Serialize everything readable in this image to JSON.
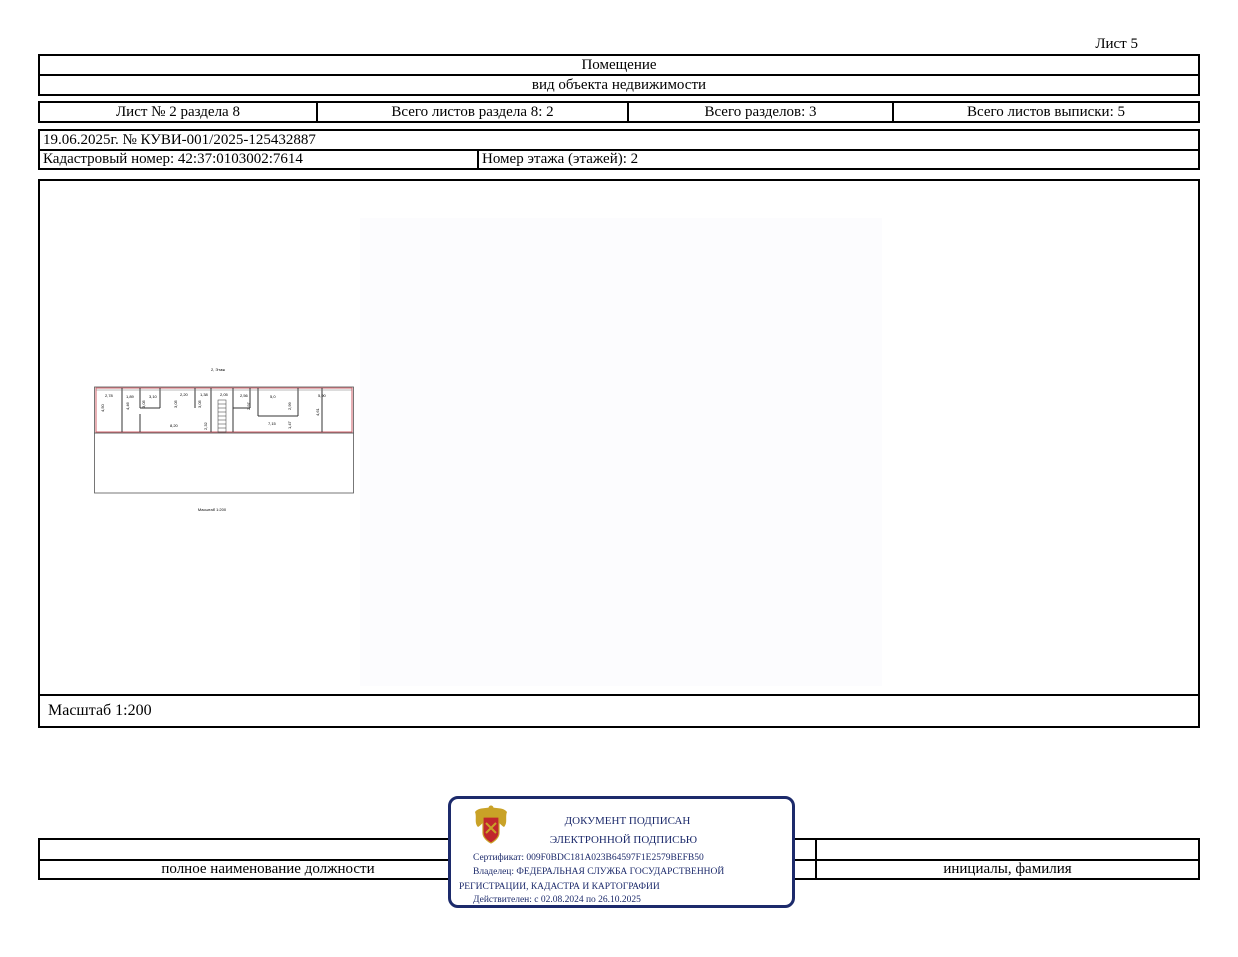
{
  "sheet": {
    "label": "Лист 5"
  },
  "header": {
    "object_type": "Помещение",
    "object_kind": "вид объекта недвижимости"
  },
  "section_row": {
    "sheet_in_section": "Лист № 2 раздела 8",
    "sheets_in_section": "Всего листов раздела 8: 2",
    "total_sections": "Всего разделов: 3",
    "total_sheets": "Всего листов выписки: 5"
  },
  "doc_info": {
    "date_number": "19.06.2025г. № КУВИ-001/2025-125432887",
    "cadastral_number": "Кадастровый номер: 42:37:0103002:7614",
    "floor_number": "Номер этажа (этажей): 2"
  },
  "plan": {
    "floor_caption": "2, Этаж",
    "scale_caption": "Масштаб 1:200",
    "dimensions": [
      "2,78",
      "1,89",
      "3,10",
      "2,20",
      "1,38",
      "2,05",
      "2,56",
      "5,0",
      "5,90",
      "4,50",
      "4,46",
      "3,05",
      "3,05",
      "3,05",
      "2,97",
      "2,99",
      "4,61",
      "8,20",
      "2,32",
      "7,15",
      "1,47"
    ]
  },
  "scale": {
    "label": "Масштаб 1:200"
  },
  "signature": {
    "position_label": "полное наименование должности",
    "name_label": "инициалы, фамилия"
  },
  "stamp": {
    "line1": "ДОКУМЕНТ ПОДПИСАН",
    "line2": "ЭЛЕКТРОННОЙ ПОДПИСЬЮ",
    "certificate": "Сертификат: 009F0BDC181A023B64597F1E2579BEFB50",
    "owner_line1": "Владелец: ФЕДЕРАЛЬНАЯ СЛУЖБА ГОСУДАРСТВЕННОЙ",
    "owner_line2": "РЕГИСТРАЦИИ, КАДАСТРА И КАРТОГРАФИИ",
    "valid": "Действителен: с 02.08.2024 по 26.10.2025"
  },
  "colors": {
    "stamp": "#1c2a6b",
    "emblem_red": "#c0272d",
    "emblem_gold": "#c9a227",
    "plan_wall": "#d0606a"
  }
}
